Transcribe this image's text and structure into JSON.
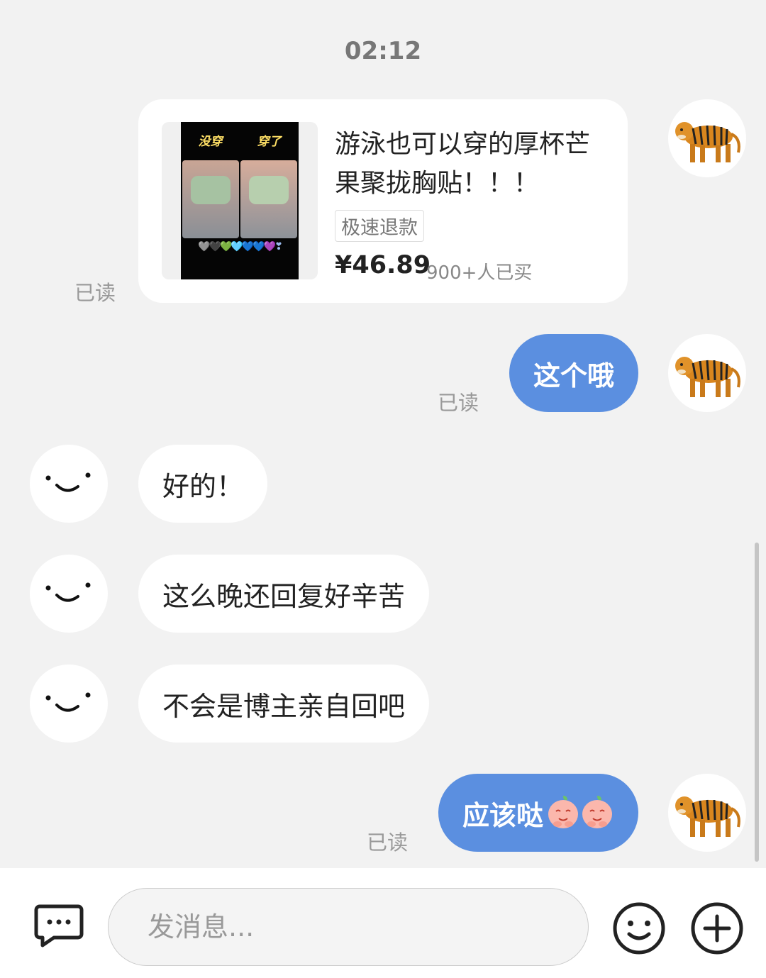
{
  "timestamp": "02:12",
  "read_label": "已读",
  "product": {
    "title": "游泳也可以穿的厚杯芒果聚拢胸贴！！！",
    "tag": "极速退款",
    "price": "¥46.89",
    "sold": "900+人已买",
    "image_labels": [
      "没穿",
      "穿了"
    ],
    "image_hearts": "🩶🖤💚🩵💙💙💜❣"
  },
  "messages": [
    {
      "side": "out",
      "text": "这个哦"
    },
    {
      "side": "in",
      "text": "好的！"
    },
    {
      "side": "in",
      "text": "这么晚还回复好辛苦"
    },
    {
      "side": "in",
      "text": "不会是博主亲自回吧"
    },
    {
      "side": "out",
      "text": "应该哒"
    }
  ],
  "input": {
    "placeholder": "发消息..."
  },
  "colors": {
    "background": "#f2f2f2",
    "outgoing_bubble": "#5b8fe0",
    "incoming_bubble": "#ffffff"
  },
  "icons": {
    "avatar_self": "tiger-avatar",
    "avatar_other": "smile-face-avatar",
    "bubble_emoji": "peach-emoji",
    "chat_toggle": "chat-bubble-icon",
    "emoji_button": "smiley-icon",
    "plus_button": "plus-circle-icon"
  }
}
